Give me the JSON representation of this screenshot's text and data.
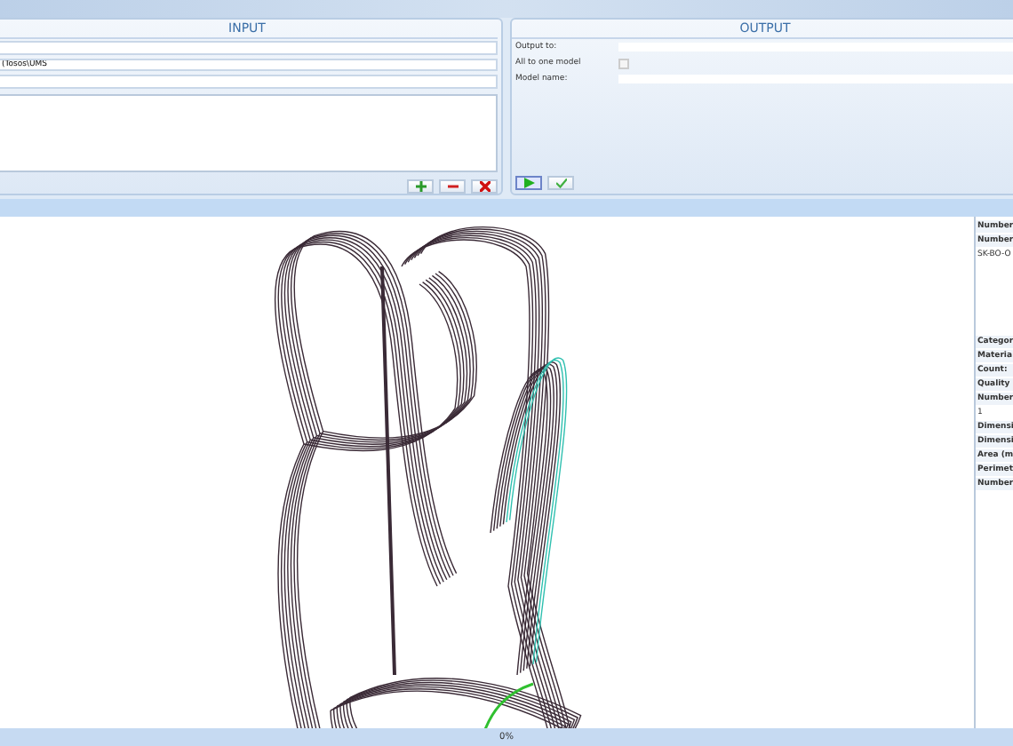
{
  "input": {
    "title": "INPUT",
    "path_field": {
      "value": "(Tosos\\UMS"
    }
  },
  "output": {
    "title": "OUTPUT",
    "output_to": {
      "label": "Output to:"
    },
    "all_to_one": {
      "label": "All to one model",
      "checked": false
    },
    "model_name": {
      "label": "Model name:"
    }
  },
  "properties": [
    {
      "kind": "label",
      "text": "Number"
    },
    {
      "kind": "label",
      "text": "Number"
    },
    {
      "kind": "value",
      "text": "SK-BO-O"
    },
    {
      "kind": "separator"
    },
    {
      "kind": "label",
      "text": "Categor"
    },
    {
      "kind": "label",
      "text": "Materia"
    },
    {
      "kind": "label",
      "text": "Count:"
    },
    {
      "kind": "label",
      "text": "Quality"
    },
    {
      "kind": "label",
      "text": "Number"
    },
    {
      "kind": "value",
      "text": "1"
    },
    {
      "kind": "label",
      "text": "Dimensi"
    },
    {
      "kind": "label",
      "text": "Dimensi"
    },
    {
      "kind": "label",
      "text": "Area (m"
    },
    {
      "kind": "label",
      "text": "Perimet"
    },
    {
      "kind": "label",
      "text": "Number"
    }
  ],
  "status_bar": {
    "progress": "0%"
  }
}
